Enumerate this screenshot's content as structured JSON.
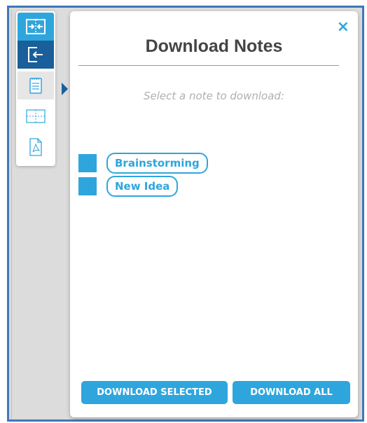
{
  "panel": {
    "title": "Download Notes",
    "close_glyph": "×",
    "instruction": "Select a note to download:"
  },
  "notes": [
    {
      "label": "Brainstorming",
      "selected": true
    },
    {
      "label": "New Idea",
      "selected": true
    }
  ],
  "buttons": {
    "download_selected": "DOWNLOAD SELECTED",
    "download_all": "DOWNLOAD ALL"
  },
  "toolbar": {
    "items": [
      {
        "icon": "expand-panel-icon",
        "state": "active-light"
      },
      {
        "icon": "exit-panel-icon",
        "state": "active-dark"
      },
      {
        "icon": "notepad-icon",
        "state": "selected"
      },
      {
        "icon": "split-view-icon",
        "state": "default"
      },
      {
        "icon": "pdf-file-icon",
        "state": "default"
      }
    ]
  },
  "colors": {
    "accent": "#2ea6dd",
    "dark_accent": "#1a5f9a",
    "frame_border": "#3f78b8",
    "title_text": "#444444",
    "placeholder_text": "#b0b0b0"
  }
}
